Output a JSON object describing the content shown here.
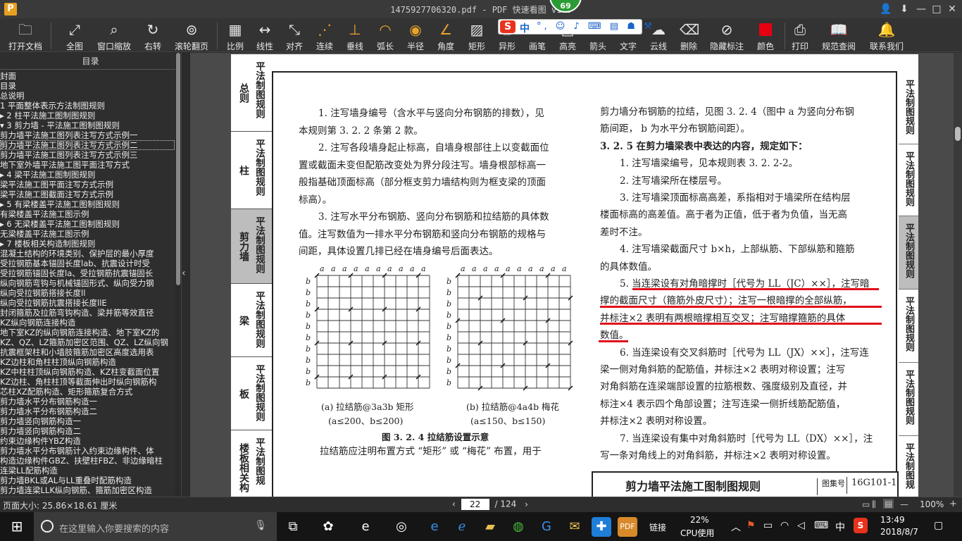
{
  "window": {
    "title": "1475927706320.pdf - PDF 快速看图 v1.9",
    "app_icon_letter": "P",
    "fps": "69",
    "user_icon": "user-icon",
    "pin_icon": "pin-icon",
    "min_icon": "minimize-icon",
    "max_icon": "maximize-icon",
    "close_icon": "close-icon"
  },
  "toolbar": {
    "items": [
      {
        "label": "打开文档",
        "icon": "folder-icon"
      },
      {
        "label": "全图",
        "icon": "fit-icon"
      },
      {
        "label": "窗口缩放",
        "icon": "magnifier-icon"
      },
      {
        "label": "右转",
        "icon": "rotate-icon"
      },
      {
        "label": "滚轮翻页",
        "icon": "mouse-icon"
      },
      {
        "label": "比例",
        "icon": "ruler-icon"
      },
      {
        "label": "线性",
        "icon": "linear-icon"
      },
      {
        "label": "对齐",
        "icon": "align-icon"
      },
      {
        "label": "连续",
        "icon": "continuous-icon"
      },
      {
        "label": "垂线",
        "icon": "perpendicular-icon"
      },
      {
        "label": "弧长",
        "icon": "arc-icon"
      },
      {
        "label": "半径",
        "icon": "radius-icon"
      },
      {
        "label": "角度",
        "icon": "angle-icon"
      },
      {
        "label": "矩形",
        "icon": "rect-hatch-icon"
      },
      {
        "label": "异形",
        "icon": "shape-icon"
      },
      {
        "label": "画笔",
        "icon": "pen-icon"
      },
      {
        "label": "高亮",
        "icon": "highlight-icon"
      },
      {
        "label": "箭头",
        "icon": "arrow-icon"
      },
      {
        "label": "文字",
        "icon": "text-icon"
      },
      {
        "label": "云线",
        "icon": "cloud-icon"
      },
      {
        "label": "删除",
        "icon": "eraser-icon"
      },
      {
        "label": "隐藏标注",
        "icon": "hide-eye-icon"
      },
      {
        "label": "颜色",
        "icon": "color-swatch-icon"
      },
      {
        "label": "打印",
        "icon": "printer-icon"
      },
      {
        "label": "规范查阅",
        "icon": "book-icon"
      },
      {
        "label": "联系我们",
        "icon": "contact-icon"
      }
    ],
    "color_swatch": "#e60012",
    "ime": {
      "logo": "S",
      "mode": "中",
      "extra": "°, ☺ ♪ ⌨ ▤ ☗ ⚒"
    }
  },
  "sidebar": {
    "header": "目录",
    "items": [
      {
        "text": "封面",
        "sel": false
      },
      {
        "text": "目录",
        "sel": false
      },
      {
        "text": "总说明",
        "sel": false
      },
      {
        "text": "1  平面整体表示方法制图规则",
        "sel": false
      },
      {
        "text": "▸  2  柱平法施工图制图规则",
        "sel": false
      },
      {
        "text": "▾  3  剪力墙 - 平法施工图制图规则",
        "sel": false
      },
      {
        "text": "    剪力墙平法施工图列表注写方式示例一",
        "sel": false
      },
      {
        "text": "    剪力墙平法施工图列表注写方式示例二",
        "sel": true
      },
      {
        "text": "    剪力墙平法施工图列表注写方式示例三",
        "sel": false
      },
      {
        "text": "    地下室外墙平法施工图平面注写方式",
        "sel": false
      },
      {
        "text": "▸  4  梁平法施工图制图规则",
        "sel": false
      },
      {
        "text": "    梁平法施工图平面注写方式示例",
        "sel": false
      },
      {
        "text": "    梁平法施工图截面注写方式示例",
        "sel": false
      },
      {
        "text": "▸  5  有梁楼盖平法施工图制图规则",
        "sel": false
      },
      {
        "text": "    有梁楼盖平法施工图示例",
        "sel": false
      },
      {
        "text": "▸  6  无梁楼盖平法施工图制图规则",
        "sel": false
      },
      {
        "text": "    无梁楼盖平法施工图示例",
        "sel": false
      },
      {
        "text": "▸  7  楼板相关构造制图规则",
        "sel": false
      },
      {
        "text": "    混凝土结构的环境类别、保护层的最小厚度",
        "sel": false
      },
      {
        "text": "    受拉钢筋基本锚固长度lab、抗震设计时受",
        "sel": false
      },
      {
        "text": "    受拉钢筋锚固长度la、受拉钢筋抗震锚固长",
        "sel": false
      },
      {
        "text": "    纵向钢筋弯钩与机械锚固形式、纵向受力钢",
        "sel": false
      },
      {
        "text": "    纵向受拉钢筋搭接长度ll",
        "sel": false
      },
      {
        "text": "    纵向受拉钢筋抗震搭接长度llE",
        "sel": false
      },
      {
        "text": "    封闭箍筋及拉筋弯钩构造、梁并筋等效直径",
        "sel": false
      },
      {
        "text": "    KZ纵向钢筋连接构造",
        "sel": false
      },
      {
        "text": "    地下室KZ的纵向钢筋连接构造、地下室KZ的",
        "sel": false
      },
      {
        "text": "    KZ、QZ、LZ箍筋加密区范围、QZ、LZ纵向钢",
        "sel": false
      },
      {
        "text": "    抗震框架柱和小墙肢箍筋加密区高度选用表",
        "sel": false
      },
      {
        "text": "    KZ边柱和角柱柱顶纵向钢筋构造",
        "sel": false
      },
      {
        "text": "    KZ中柱柱顶纵向钢筋构造、KZ柱变截面位置",
        "sel": false
      },
      {
        "text": "    KZ边柱、角柱柱顶等截面伸出时纵向钢筋构",
        "sel": false
      },
      {
        "text": "    芯柱XZ配筋构造、矩形箍筋复合方式",
        "sel": false
      },
      {
        "text": "    剪力墙水平分布钢筋构造一",
        "sel": false
      },
      {
        "text": "    剪力墙水平分布钢筋构造二",
        "sel": false
      },
      {
        "text": "    剪力墙竖向钢筋构造一",
        "sel": false
      },
      {
        "text": "    剪力墙竖向钢筋构造二",
        "sel": false
      },
      {
        "text": "    约束边缘构件YBZ构造",
        "sel": false
      },
      {
        "text": "    剪力墙水平分布钢筋计入约束边缘构件、体",
        "sel": false
      },
      {
        "text": "    构造边缘构件GBZ、扶壁柱FBZ、非边缘暗柱",
        "sel": false
      },
      {
        "text": "    连梁LL配筋构造",
        "sel": false
      },
      {
        "text": "    剪力墙BKL或AL与LL重叠时配筋构造",
        "sel": false
      },
      {
        "text": "    剪力墙连梁LLK纵向钢筋、箍筋加密区构造",
        "sel": false
      }
    ]
  },
  "page": {
    "left_tabs": [
      {
        "cat": "总则",
        "title": "平法制图规则"
      },
      {
        "cat": "柱",
        "title": "平法制图规则"
      },
      {
        "cat": "剪力墙",
        "title": "平法制图规则"
      },
      {
        "cat": "梁",
        "title": "平法制图规则"
      },
      {
        "cat": "板",
        "title": "平法制图规则"
      },
      {
        "cat": "楼板相关构",
        "title": "平法制图规"
      }
    ],
    "right_tabs": [
      "平法制图规则",
      "平法制图规则",
      "平法制图规则",
      "平法制图规则",
      "平法制图规则",
      "平法制图规"
    ],
    "left_col": [
      "1. 注写墙身编号（含水平与竖向分布钢筋的排数），见",
      "本规则第 3. 2. 2 条第 2 款。",
      "2. 注写各段墙身起止标高，自墙身根部往上以变截面位",
      "置或截面未变但配筋改变处为界分段注写。墙身根部标高一",
      "般指基础顶面标高（部分框支剪力墙结构则为框支梁的顶面",
      "标高）。",
      "3. 注写水平分布钢筋、竖向分布钢筋和拉结筋的具体数",
      "值。注写数值为一排水平分布钢筋和竖向分布钢筋的规格与",
      "间距，具体设置几排已经在墙身编号后面表达。"
    ],
    "grid_label_a": "a",
    "grid_label_b": "b",
    "fig_a_caption": "(a) 拉结筋@3a3b 矩形",
    "fig_a_range": "(a≤200、b≤200)",
    "fig_b_caption": "(b) 拉结筋@4a4b 梅花",
    "fig_b_range": "(a≤150、b≤150)",
    "fig_title": "图 3. 2. 4 拉结筋设置示意",
    "fig_note": "拉结筋应注明布置方式 “矩形” 或 “梅花” 布置，用于",
    "right_col": [
      "剪力墙分布钢筋的拉结，见图 3. 2. 4（图中 a 为竖向分布钢",
      "筋间距，  b 为水平分布钢筋间距）。",
      "3. 2. 5  在剪力墙梁表中表达的内容，规定如下：",
      "1. 注写墙梁编号，见本规则表 3. 2. 2-2。",
      "2. 注写墙梁所在楼层号。",
      "3. 注写墙梁顶面标高高差，系指相对于墙梁所在结构层",
      "楼面标高的高差值。高于者为正值，低于者为负值，当无高",
      "差时不注。",
      "4. 注写墙梁截面尺寸 b×h，上部纵筋、下部纵筋和箍筋",
      "的具体数值。",
      "5. 当连梁设有对角暗撑时［代号为 LL（JC）××］，注写暗",
      "撑的截面尺寸（箍筋外皮尺寸）；注写一根暗撑的全部纵筋，",
      "并标注×2  表明有两根暗撑相互交叉；注写暗撑箍筋的具体",
      "数值。",
      "6. 当连梁设有交叉斜筋时［代号为 LL（JX）××］，注写连",
      "梁一侧对角斜筋的配筋值，并标注×2  表明对称设置；注写",
      "对角斜筋在连梁端部设置的拉筋根数、强度级别及直径，并",
      "标注×4  表示四个角部设置；注写连梁一侧折线筋配筋值，",
      "并标注×2 表明对称设置。",
      "7. 当连梁设有集中对角斜筋时［代号为 LL（DX）××］，注",
      "写一条对角线上的对角斜筋，并标注×2 表明对称设置。"
    ],
    "footer_title": "剪力墙平法施工图制图规则",
    "footer_atlas_label": "图集号",
    "footer_code": "16G101-1"
  },
  "status": {
    "page_size": "页面大小: 25.86×18.61 厘米",
    "current_page": "22",
    "total_pages": "/ 124",
    "prev": "‹",
    "next": "›",
    "zoom": "100%"
  },
  "taskbar": {
    "search_placeholder": "在这里输入你要搜索的内容",
    "link_label": "链接",
    "cpu_percent": "22%",
    "cpu_label": "CPU使用",
    "ime_lang": "中",
    "time": "13:49",
    "date": "2018/8/7"
  },
  "colors": {
    "red_underline": "#e0101a",
    "accent_orange": "#e8a42a"
  }
}
